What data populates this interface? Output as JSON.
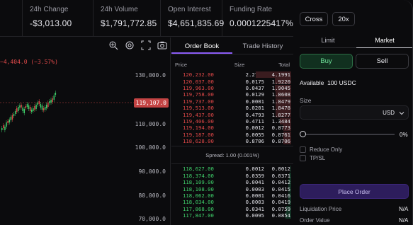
{
  "stats": [
    {
      "label": "24h Change",
      "value": "-$3,013.00"
    },
    {
      "label": "24h Volume",
      "value": "$1,791,772.85"
    },
    {
      "label": "Open Interest",
      "value": "$4,651,835.69"
    },
    {
      "label": "Funding Rate",
      "value": "0.0001225417%"
    }
  ],
  "chart": {
    "change_text": "−4,404.0 (−3.57%)",
    "current_price": "119,107.0",
    "axis_labels": [
      "130,000.0",
      "110,000.0",
      "100,000.0",
      "90,000.0",
      "80,000.0",
      "70,000.0"
    ],
    "tools": [
      "crosshair-icon",
      "settings-icon",
      "fullscreen-icon",
      "camera-icon"
    ]
  },
  "orderbook": {
    "tabs": [
      "Order Book",
      "Trade History"
    ],
    "active_tab": "Order Book",
    "columns": [
      "Price",
      "Size",
      "Total"
    ],
    "asks": [
      {
        "price": "120,232.00",
        "size": "2.2771",
        "total": "4.1991",
        "depth": 1.0
      },
      {
        "price": "120,037.00",
        "size": "0.0175",
        "total": "1.9220",
        "depth": 0.46
      },
      {
        "price": "119,963.00",
        "size": "0.0437",
        "total": "1.9045",
        "depth": 0.45
      },
      {
        "price": "119,758.00",
        "size": "0.0129",
        "total": "1.8608",
        "depth": 0.44
      },
      {
        "price": "119,737.00",
        "size": "0.0001",
        "total": "1.8479",
        "depth": 0.44
      },
      {
        "price": "119,513.00",
        "size": "0.0201",
        "total": "1.8478",
        "depth": 0.44
      },
      {
        "price": "119,437.00",
        "size": "0.4793",
        "total": "1.8277",
        "depth": 0.43
      },
      {
        "price": "119,406.00",
        "size": "0.4711",
        "total": "1.3484",
        "depth": 0.32
      },
      {
        "price": "119,194.00",
        "size": "0.0012",
        "total": "0.8773",
        "depth": 0.21
      },
      {
        "price": "119,187.00",
        "size": "0.0055",
        "total": "0.8761",
        "depth": 0.21
      },
      {
        "price": "118,628.00",
        "size": "0.8706",
        "total": "0.8706",
        "depth": 0.21
      }
    ],
    "spread": "Spread: 1.00 (0.001%)",
    "bids": [
      {
        "price": "118,627.00",
        "size": "0.0012",
        "total": "0.0012",
        "depth": 0.02
      },
      {
        "price": "118,374.00",
        "size": "0.0359",
        "total": "0.0371",
        "depth": 0.06
      },
      {
        "price": "118,109.00",
        "size": "0.0041",
        "total": "0.0412",
        "depth": 0.07
      },
      {
        "price": "118,108.00",
        "size": "0.0003",
        "total": "0.0415",
        "depth": 0.07
      },
      {
        "price": "118,062.00",
        "size": "0.0001",
        "total": "0.0416",
        "depth": 0.07
      },
      {
        "price": "118,034.00",
        "size": "0.0003",
        "total": "0.0419",
        "depth": 0.07
      },
      {
        "price": "117,868.00",
        "size": "0.0341",
        "total": "0.0759",
        "depth": 0.13
      },
      {
        "price": "117,847.00",
        "size": "0.0095",
        "total": "0.0854",
        "depth": 0.15
      }
    ]
  },
  "panel": {
    "margin_mode": "Cross",
    "leverage": "20x",
    "order_tabs": [
      "Limit",
      "Market"
    ],
    "active_order_tab": "Market",
    "buy_label": "Buy",
    "sell_label": "Sell",
    "available_label": "Available",
    "available_value": "100 USDC",
    "size_label": "Size",
    "size_unit": "USD",
    "slider_value": "0%",
    "reduce_only_label": "Reduce Only",
    "tpsl_label": "TP/SL",
    "place_order_label": "Place Order",
    "liq_price_label": "Liquidation Price",
    "liq_price_value": "N/A",
    "order_value_label": "Order Value",
    "order_value_value": "N/A"
  },
  "colors": {
    "accent": "#8b5cf6",
    "buy": "#3fcf6a",
    "sell": "#e04848"
  }
}
